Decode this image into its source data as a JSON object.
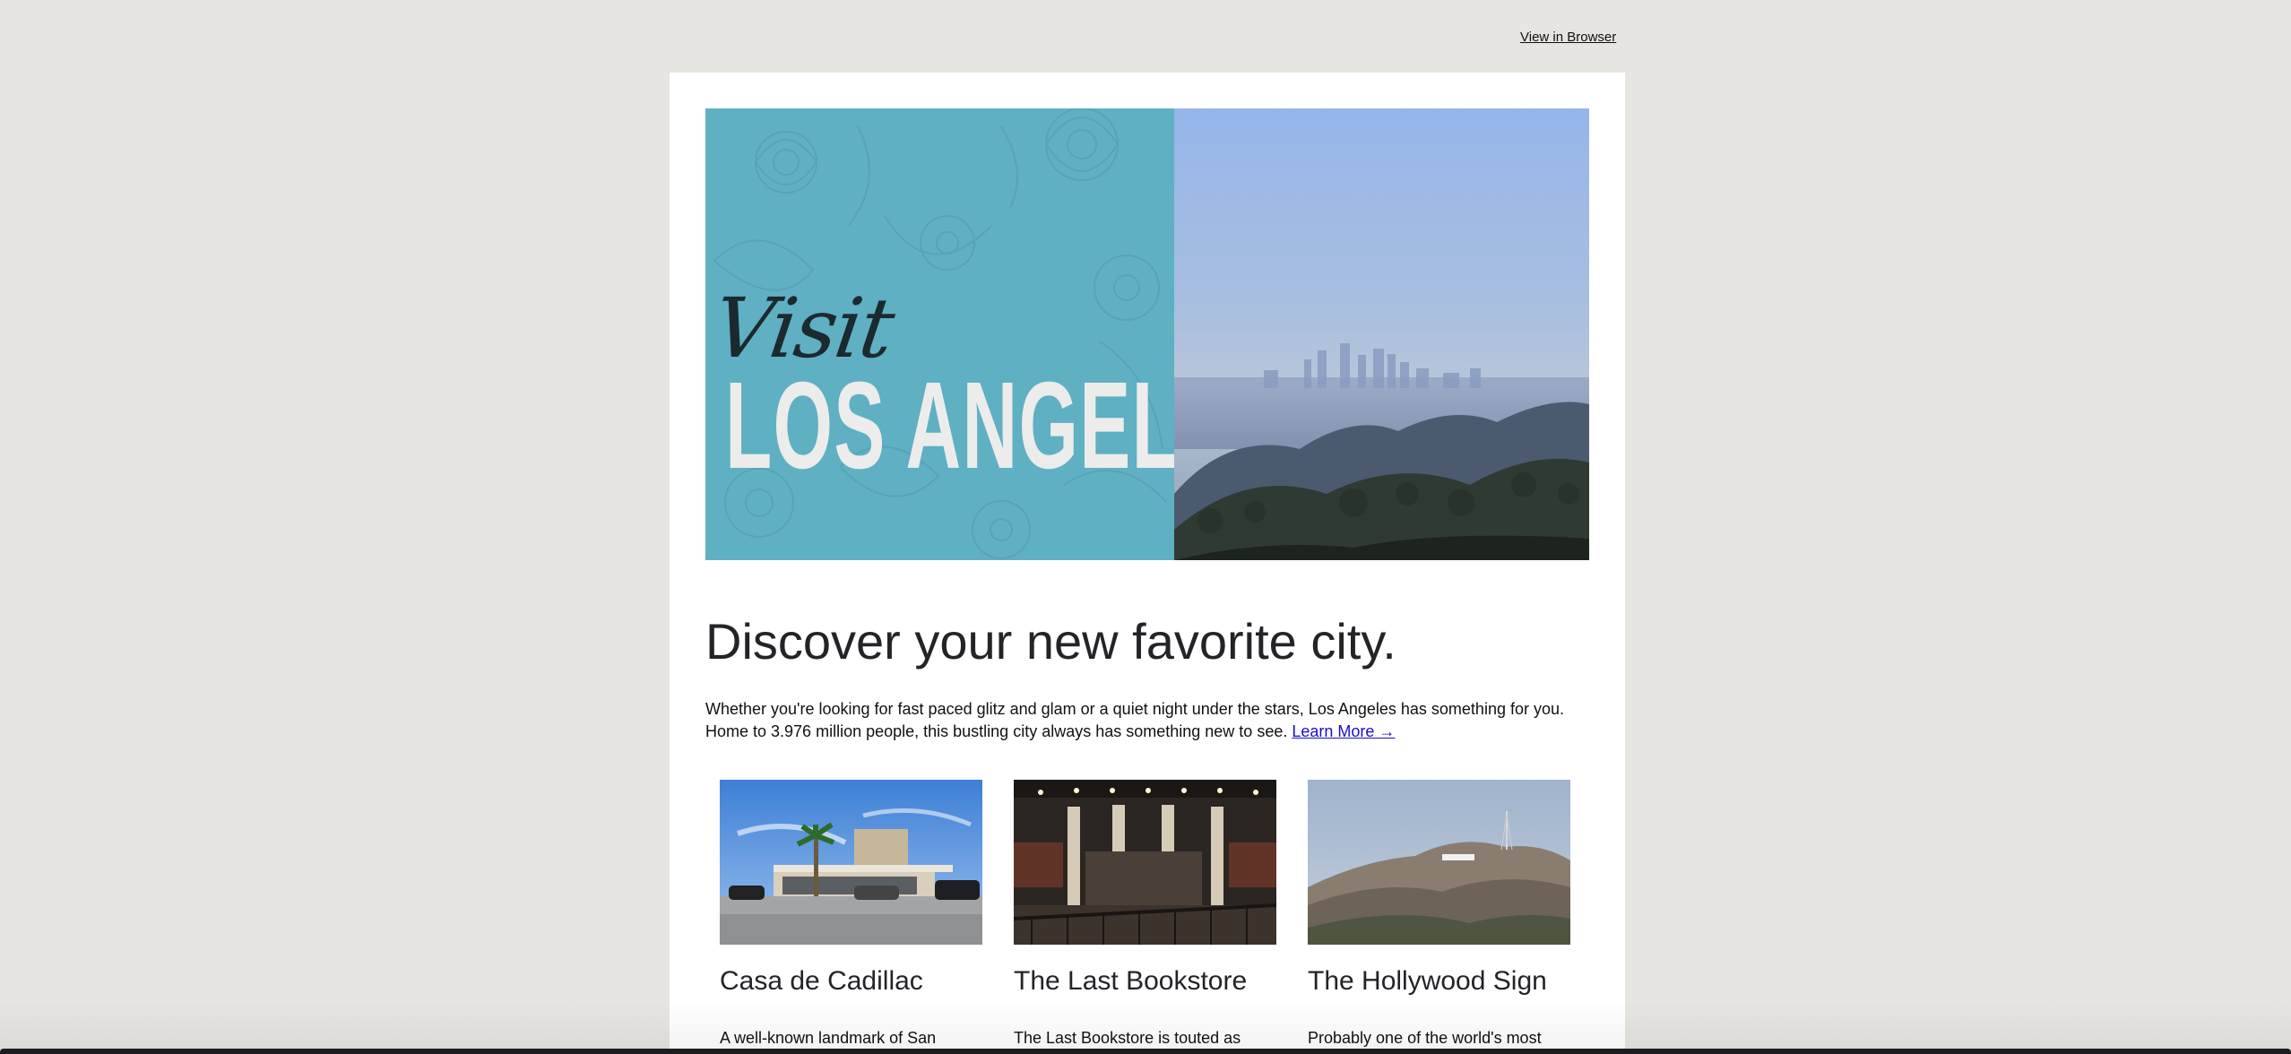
{
  "header": {
    "view_in_browser": "View in Browser"
  },
  "hero": {
    "visit_text": "Visit",
    "city_text": "LOS ANGELES"
  },
  "main": {
    "headline": "Discover your new favorite city.",
    "intro_text": "Whether you're looking for fast paced glitz and glam or a quiet night under the stars, Los Angeles has something for you. Home to 3.976 million people, this bustling city always has something new to see. ",
    "learn_more": "Learn More →"
  },
  "columns": [
    {
      "title": "Casa de Cadillac",
      "text": "A well-known landmark of San"
    },
    {
      "title": "The Last Bookstore",
      "text": "The Last Bookstore is touted as"
    },
    {
      "title": "The Hollywood Sign",
      "text": "Probably one of the world's most"
    }
  ],
  "icons": {
    "arrow": "arrow-right-icon"
  },
  "colors": {
    "page_background": "#e6e5e1",
    "card_background": "#ffffff",
    "hero_teal": "#5fb0c3",
    "link_blue": "#1a0dcc",
    "heading_text": "#222428"
  }
}
